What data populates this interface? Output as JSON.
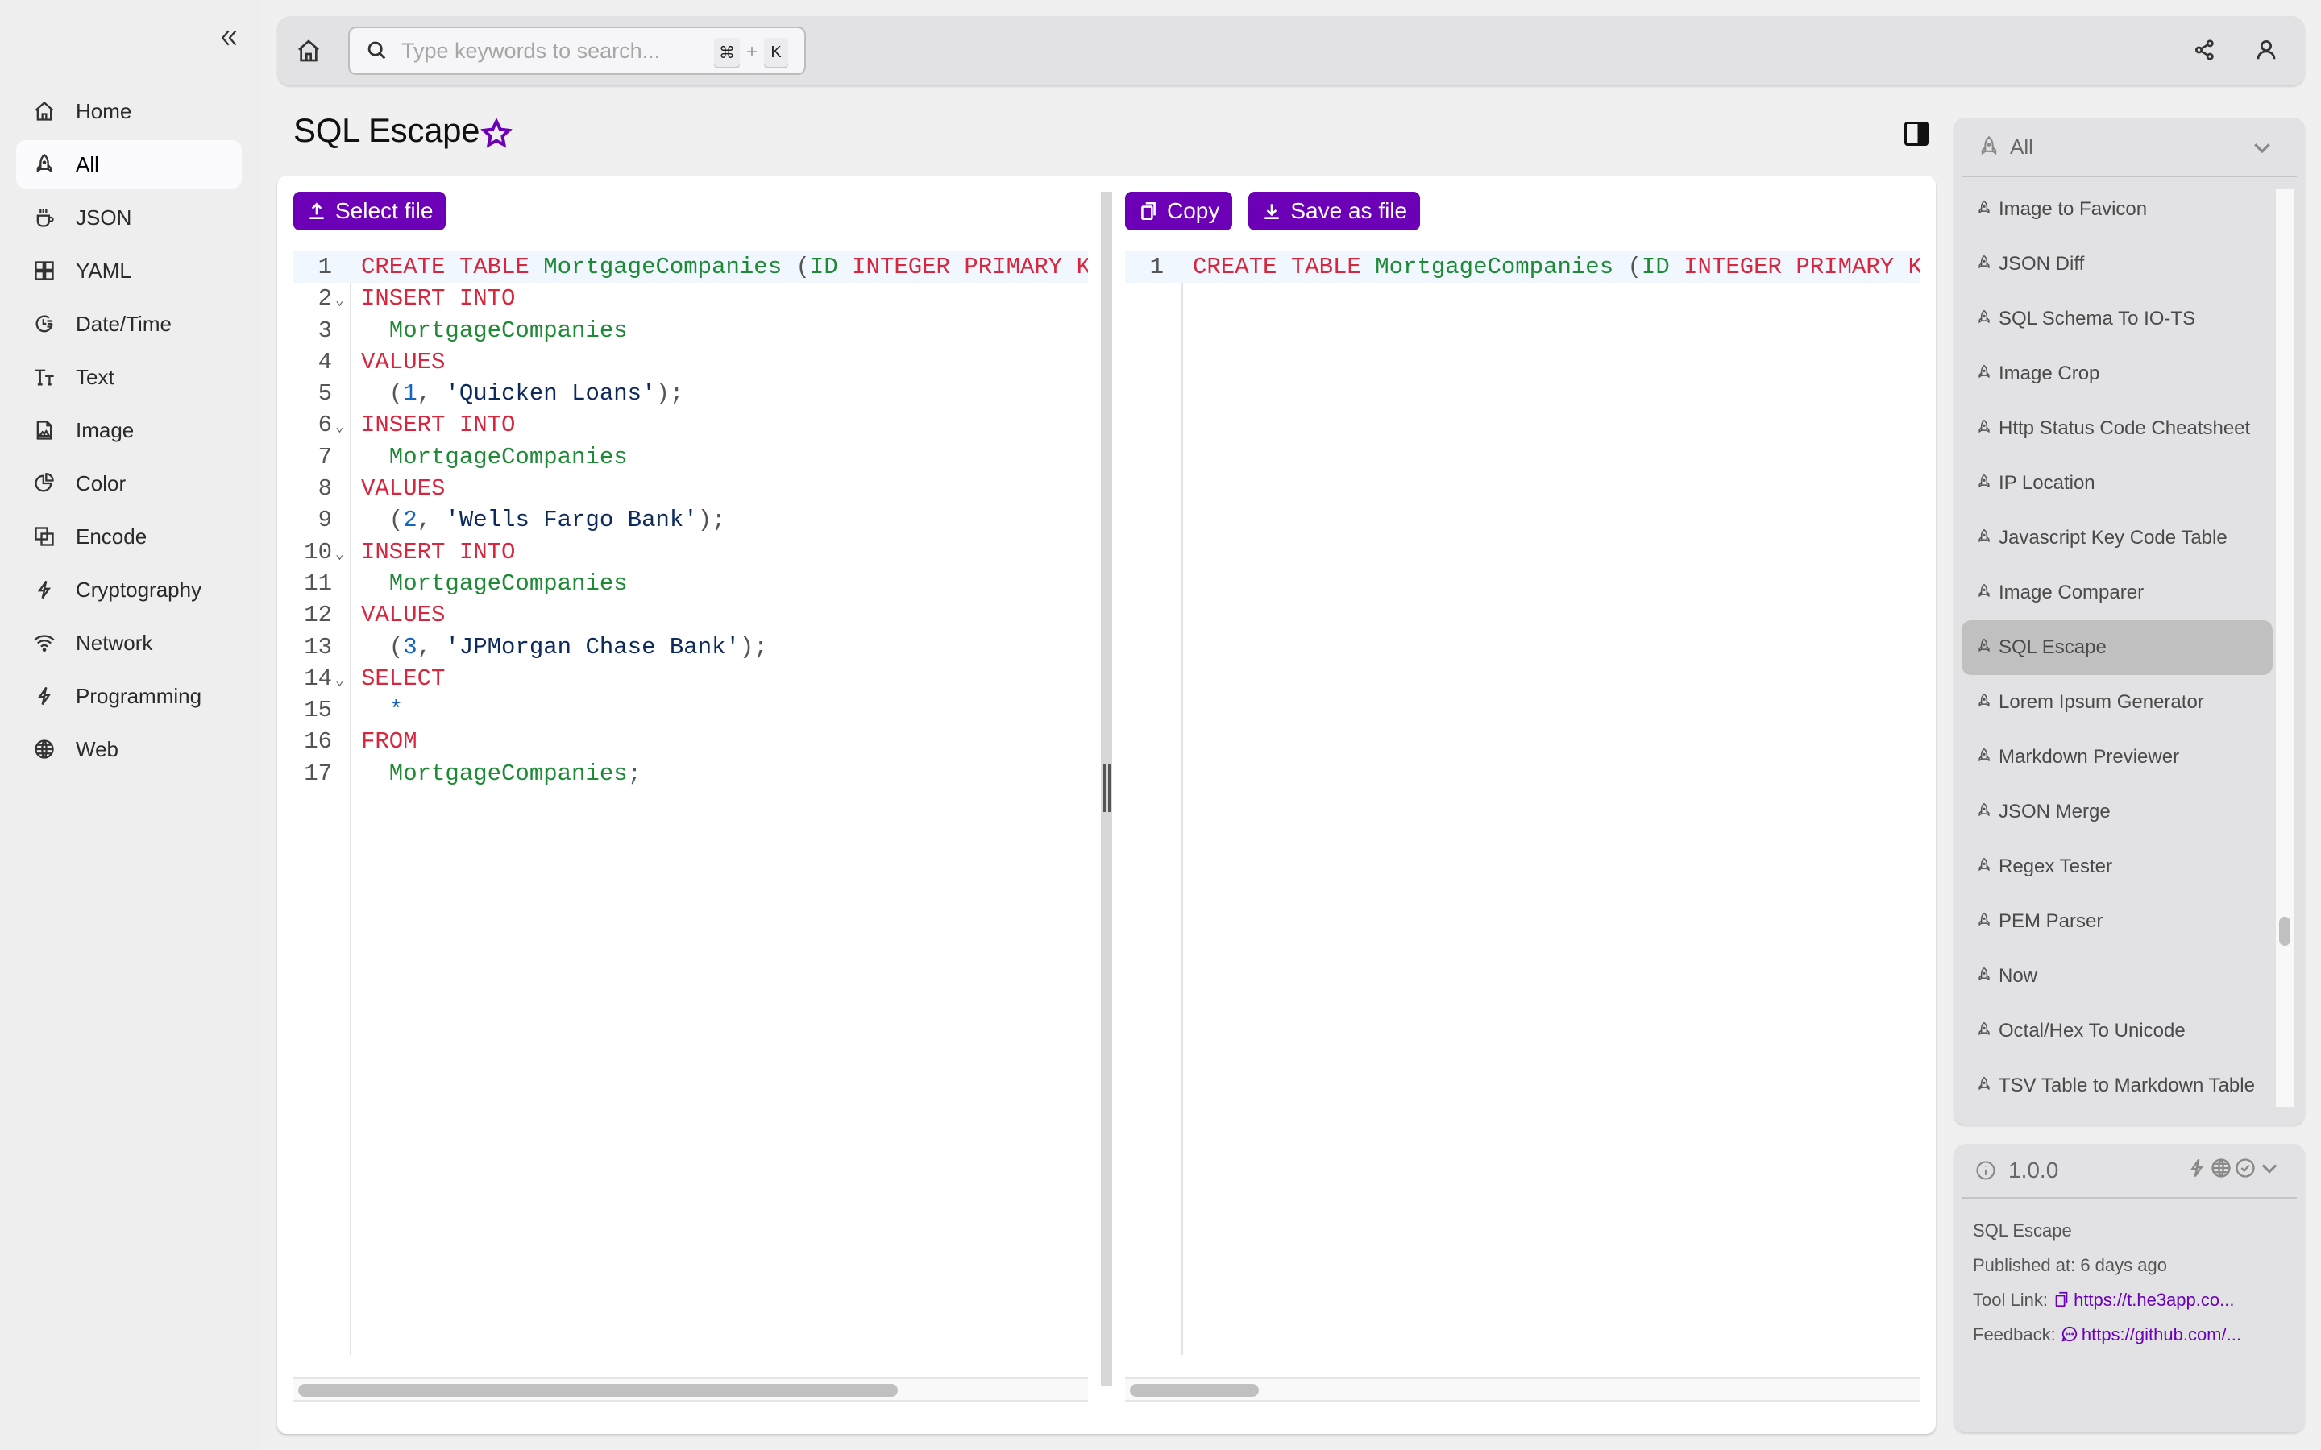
{
  "sidebar": {
    "collapse_icon": "double-chevron-left-icon",
    "items": [
      {
        "label": "Home",
        "icon": "home-icon",
        "active": false
      },
      {
        "label": "All",
        "icon": "rocket-icon",
        "active": true
      },
      {
        "label": "JSON",
        "icon": "cup-icon",
        "active": false
      },
      {
        "label": "YAML",
        "icon": "grid-icon",
        "active": false
      },
      {
        "label": "Date/Time",
        "icon": "clock-icon",
        "active": false
      },
      {
        "label": "Text",
        "icon": "text-size-icon",
        "active": false
      },
      {
        "label": "Image",
        "icon": "image-file-icon",
        "active": false
      },
      {
        "label": "Color",
        "icon": "pie-chart-icon",
        "active": false
      },
      {
        "label": "Encode",
        "icon": "overlap-squares-icon",
        "active": false
      },
      {
        "label": "Cryptography",
        "icon": "lightning-icon",
        "active": false
      },
      {
        "label": "Network",
        "icon": "wifi-icon",
        "active": false
      },
      {
        "label": "Programming",
        "icon": "lightning-icon",
        "active": false
      },
      {
        "label": "Web",
        "icon": "globe-icon",
        "active": false
      }
    ]
  },
  "topbar": {
    "search_placeholder": "Type keywords to search...",
    "search_value": "",
    "shortcut_key1": "⌘",
    "shortcut_plus": "+",
    "shortcut_key2": "K"
  },
  "page": {
    "title": "SQL Escape",
    "favorited": false
  },
  "input_pane": {
    "select_file_label": "Select file",
    "lines": [
      {
        "n": "1",
        "fold": false,
        "tokens": [
          [
            "kw",
            "CREATE TABLE "
          ],
          [
            "id",
            "MortgageCompanies "
          ],
          [
            "pun",
            "("
          ],
          [
            "id",
            "ID "
          ],
          [
            "kw",
            "INTEGER PRIMARY KEY"
          ]
        ]
      },
      {
        "n": "2",
        "fold": true,
        "tokens": [
          [
            "kw",
            "INSERT INTO"
          ]
        ]
      },
      {
        "n": "3",
        "fold": false,
        "tokens": [
          [
            "id",
            "  MortgageCompanies"
          ]
        ]
      },
      {
        "n": "4",
        "fold": false,
        "tokens": [
          [
            "kw",
            "VALUES"
          ]
        ]
      },
      {
        "n": "5",
        "fold": false,
        "tokens": [
          [
            "pun",
            "  ("
          ],
          [
            "num",
            "1"
          ],
          [
            "pun",
            ", "
          ],
          [
            "str",
            "'Quicken Loans'"
          ],
          [
            "pun",
            ");"
          ]
        ]
      },
      {
        "n": "6",
        "fold": true,
        "tokens": [
          [
            "kw",
            "INSERT INTO"
          ]
        ]
      },
      {
        "n": "7",
        "fold": false,
        "tokens": [
          [
            "id",
            "  MortgageCompanies"
          ]
        ]
      },
      {
        "n": "8",
        "fold": false,
        "tokens": [
          [
            "kw",
            "VALUES"
          ]
        ]
      },
      {
        "n": "9",
        "fold": false,
        "tokens": [
          [
            "pun",
            "  ("
          ],
          [
            "num",
            "2"
          ],
          [
            "pun",
            ", "
          ],
          [
            "str",
            "'Wells Fargo Bank'"
          ],
          [
            "pun",
            ");"
          ]
        ]
      },
      {
        "n": "10",
        "fold": true,
        "tokens": [
          [
            "kw",
            "INSERT INTO"
          ]
        ]
      },
      {
        "n": "11",
        "fold": false,
        "tokens": [
          [
            "id",
            "  MortgageCompanies"
          ]
        ]
      },
      {
        "n": "12",
        "fold": false,
        "tokens": [
          [
            "kw",
            "VALUES"
          ]
        ]
      },
      {
        "n": "13",
        "fold": false,
        "tokens": [
          [
            "pun",
            "  ("
          ],
          [
            "num",
            "3"
          ],
          [
            "pun",
            ", "
          ],
          [
            "str",
            "'JPMorgan Chase Bank'"
          ],
          [
            "pun",
            ");"
          ]
        ]
      },
      {
        "n": "14",
        "fold": true,
        "tokens": [
          [
            "kw",
            "SELECT"
          ]
        ]
      },
      {
        "n": "15",
        "fold": false,
        "tokens": [
          [
            "num",
            "  *"
          ]
        ]
      },
      {
        "n": "16",
        "fold": false,
        "tokens": [
          [
            "kw",
            "FROM"
          ]
        ]
      },
      {
        "n": "17",
        "fold": false,
        "tokens": [
          [
            "id",
            "  MortgageCompanies"
          ],
          [
            "pun",
            ";"
          ]
        ]
      }
    ]
  },
  "output_pane": {
    "copy_label": "Copy",
    "save_label": "Save as file",
    "lines": [
      {
        "n": "1",
        "fold": false,
        "tokens": [
          [
            "kw",
            "CREATE TABLE "
          ],
          [
            "id",
            "MortgageCompanies "
          ],
          [
            "pun",
            "("
          ],
          [
            "id",
            "ID "
          ],
          [
            "kw",
            "INTEGER PRIMARY KEY"
          ]
        ]
      }
    ]
  },
  "tool_panel": {
    "category_label": "All",
    "items": [
      {
        "label": "Image to Favicon",
        "active": false
      },
      {
        "label": "JSON Diff",
        "active": false
      },
      {
        "label": "SQL Schema To IO-TS",
        "active": false
      },
      {
        "label": "Image Crop",
        "active": false
      },
      {
        "label": "Http Status Code Cheatsheet",
        "active": false
      },
      {
        "label": "IP Location",
        "active": false
      },
      {
        "label": "Javascript Key Code Table",
        "active": false
      },
      {
        "label": "Image Comparer",
        "active": false
      },
      {
        "label": "SQL Escape",
        "active": true
      },
      {
        "label": "Lorem Ipsum Generator",
        "active": false
      },
      {
        "label": "Markdown Previewer",
        "active": false
      },
      {
        "label": "JSON Merge",
        "active": false
      },
      {
        "label": "Regex Tester",
        "active": false
      },
      {
        "label": "PEM Parser",
        "active": false
      },
      {
        "label": "Now",
        "active": false
      },
      {
        "label": "Octal/Hex To Unicode",
        "active": false
      },
      {
        "label": "TSV Table to Markdown Table",
        "active": false
      }
    ]
  },
  "info_card": {
    "version": "1.0.0",
    "tool_name": "SQL Escape",
    "published_label": "Published at:",
    "published_value": "6 days ago",
    "tool_link_label": "Tool Link:",
    "tool_link_value": "https://t.he3app.co...",
    "feedback_label": "Feedback:",
    "feedback_value": "https://github.com/..."
  },
  "colors": {
    "accent": "#6b00b6",
    "keyword": "#d7263d",
    "identifier": "#1e8a35",
    "string": "#0d2a5c",
    "number": "#1565c0"
  }
}
